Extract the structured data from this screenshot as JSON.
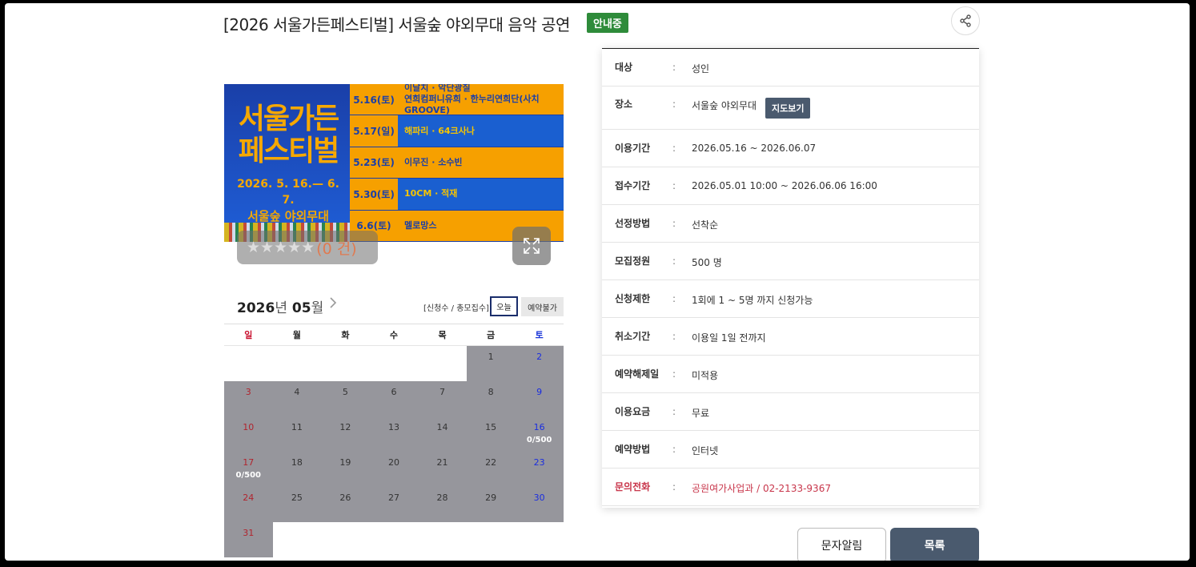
{
  "header": {
    "title": "[2026 서울가든페스티벌] 서울숲 야외무대 음악 공연",
    "status_badge": "안내중",
    "share_icon": "share-icon"
  },
  "poster": {
    "title_line1": "서울가든",
    "title_line2": "페스티벌",
    "date_range": "2026. 5. 16.— 6. 7.",
    "venue": "서울숲 야외무대",
    "schedule": [
      {
        "date": "5.16(토)",
        "acts": "이날치 · 악단광칠\n연희컴퍼니유희 · 한누리연희단(사치GROOVE)",
        "style": "o"
      },
      {
        "date": "5.17(일)",
        "acts": "해파리 · 64크사나",
        "style": "b"
      },
      {
        "date": "5.23(토)",
        "acts": "이무진 · 소수빈",
        "style": "o"
      },
      {
        "date": "5.30(토)",
        "acts": "10CM · 적재",
        "style": "b"
      },
      {
        "date": "6.6(토)",
        "acts": "멜로망스",
        "style": "o"
      }
    ],
    "rating_stars": "★★★★★",
    "rating_count": "(0 건)",
    "zoom_icon": "expand-icon"
  },
  "calendar": {
    "year": "2026",
    "year_unit": "년",
    "month": "05",
    "month_unit": "월",
    "next_icon": "chevron-right-icon",
    "legend": "[신청수 / 총모집수]",
    "today_label": "오늘",
    "unavailable_label": "예약불가",
    "weekdays": [
      "일",
      "월",
      "화",
      "수",
      "목",
      "금",
      "토"
    ],
    "weeks": [
      [
        null,
        null,
        null,
        null,
        null,
        {
          "d": "1"
        },
        {
          "d": "2"
        }
      ],
      [
        {
          "d": "3"
        },
        {
          "d": "4"
        },
        {
          "d": "5"
        },
        {
          "d": "6"
        },
        {
          "d": "7"
        },
        {
          "d": "8"
        },
        {
          "d": "9"
        }
      ],
      [
        {
          "d": "10"
        },
        {
          "d": "11"
        },
        {
          "d": "12"
        },
        {
          "d": "13"
        },
        {
          "d": "14"
        },
        {
          "d": "15"
        },
        {
          "d": "16",
          "sub": "0/500"
        }
      ],
      [
        {
          "d": "17",
          "sub": "0/500"
        },
        {
          "d": "18"
        },
        {
          "d": "19"
        },
        {
          "d": "20"
        },
        {
          "d": "21"
        },
        {
          "d": "22"
        },
        {
          "d": "23"
        }
      ],
      [
        {
          "d": "24"
        },
        {
          "d": "25"
        },
        {
          "d": "26"
        },
        {
          "d": "27"
        },
        {
          "d": "28"
        },
        {
          "d": "29"
        },
        {
          "d": "30"
        }
      ],
      [
        {
          "d": "31"
        },
        null,
        null,
        null,
        null,
        null,
        null
      ]
    ]
  },
  "info": {
    "rows": [
      {
        "label": "대상",
        "value": "성인"
      },
      {
        "label": "장소",
        "value": "서울숲 야외무대",
        "button": "지도보기"
      },
      {
        "label": "이용기간",
        "value": "2026.05.16 ~ 2026.06.07"
      },
      {
        "label": "접수기간",
        "value": "2026.05.01 10:00 ~ 2026.06.06 16:00"
      },
      {
        "label": "선정방법",
        "value": "선착순"
      },
      {
        "label": "모집정원",
        "value": "500 명"
      },
      {
        "label": "신청제한",
        "value": "1회에 1 ~ 5명 까지 신청가능"
      },
      {
        "label": "취소기간",
        "value": "이용일 1일 전까지"
      },
      {
        "label": "예약해제일",
        "value": "미적용"
      },
      {
        "label": "이용요금",
        "value": "무료"
      },
      {
        "label": "예약방법",
        "value": "인터넷"
      },
      {
        "label": "문의전화",
        "value": "공원여가사업과 / 02-2133-9367",
        "highlight": true
      }
    ]
  },
  "actions": {
    "sms_label": "문자알림",
    "list_label": "목록"
  }
}
